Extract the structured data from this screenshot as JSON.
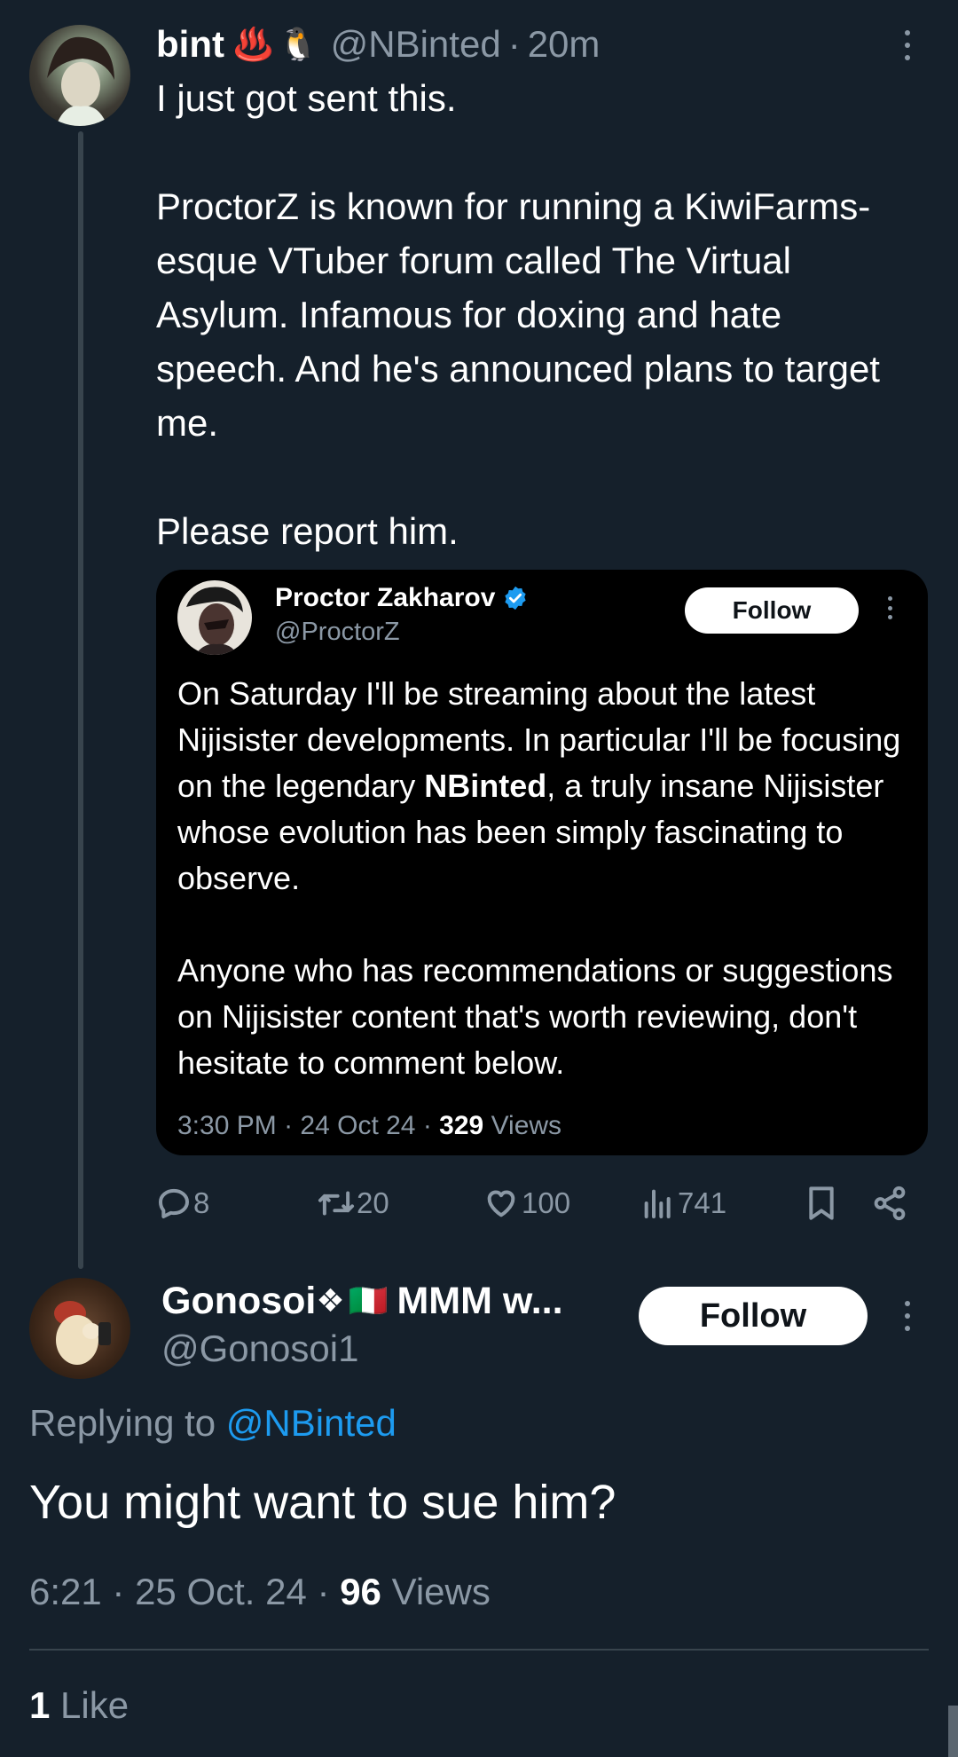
{
  "tweet": {
    "display_name": "bint",
    "name_emojis": [
      "♨️",
      "🐧"
    ],
    "handle": "@NBinted",
    "separator": "·",
    "time_ago": "20m",
    "paragraphs": [
      "I just got sent this.",
      "ProctorZ is known for running a KiwiFarms-esque VTuber forum called The Virtual Asylum. Infamous for doxing and hate speech. And he's announced plans to target me.",
      "Please report him."
    ],
    "quote": {
      "display_name": "Proctor Zakharov",
      "handle": "@ProctorZ",
      "follow_label": "Follow",
      "p1_before": "On Saturday I'll be streaming about the latest Nijisister developments. In particular I'll be focusing on the legendary ",
      "p1_bold": "NBinted",
      "p1_after": ", a truly insane Nijisister whose evolution has been simply fascinating to observe.",
      "p2": "Anyone who has recommendations or suggestions on Nijisister content that's worth reviewing, don't hesitate to comment below.",
      "meta_time": "3:30 PM",
      "meta_date": "24 Oct 24",
      "meta_views_count": "329",
      "meta_views_label": "Views"
    },
    "actions": {
      "replies": "8",
      "reposts": "20",
      "likes": "100",
      "views": "741"
    }
  },
  "reply": {
    "display_name": "Gonosoi",
    "name_emojis": [
      "❖",
      "🇮🇹"
    ],
    "name_suffix": "MMM w...",
    "handle": "@Gonosoi1",
    "follow_label": "Follow",
    "replying_prefix": "Replying to",
    "replying_handle": "@NBinted",
    "text": "You might want to sue him?",
    "time": "6:21",
    "date": "25 Oct. 24",
    "views_count": "96",
    "views_label": "Views",
    "likes_count": "1",
    "likes_label": "Like"
  },
  "colors": {
    "background": "#15202b",
    "quote_background": "#000000",
    "muted_text": "#8b98a5",
    "link": "#1d9bf0",
    "verified": "#1d9bf0",
    "thread_line": "#38444d",
    "divider": "#38444d"
  },
  "icons": [
    "more-vertical-icon",
    "verified-badge-icon",
    "reply-icon",
    "repost-icon",
    "like-icon",
    "views-icon",
    "bookmark-icon",
    "share-icon"
  ]
}
